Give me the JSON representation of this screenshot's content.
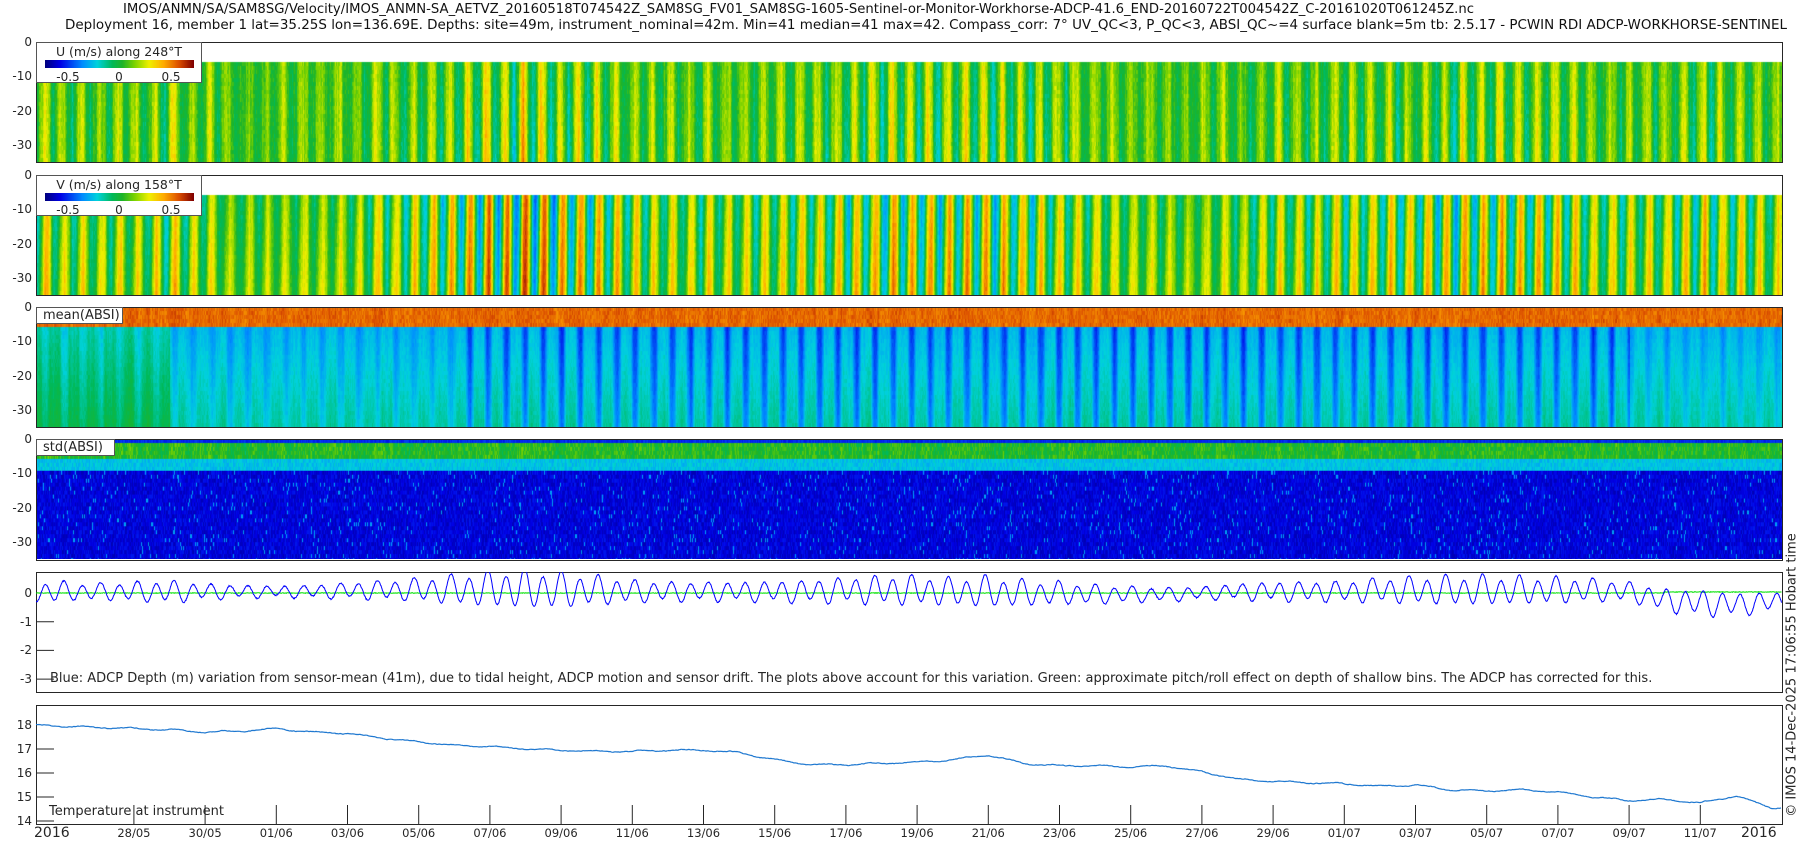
{
  "title": {
    "line1": "IMOS/ANMN/SA/SAM8SG/Velocity/IMOS_ANMN-SA_AETVZ_20160518T074542Z_SAM8SG_FV01_SAM8SG-1605-Sentinel-or-Monitor-Workhorse-ADCP-41.6_END-20160722T004542Z_C-20161020T061245Z.nc",
    "line2": "Deployment 16, member 1 lat=35.25S lon=136.69E. Depths: site=49m, instrument_nominal=42m. Min=41 median=41 max=42. Compass_corr: 7° UV_QC<3, P_QC<3, ABSI_QC~=4 surface blank=5m tb: 2.5.17 - PCWIN RDI ADCP-WORKHORSE-SENTINEL"
  },
  "credit": "© IMOS 14-Dec-2025 17:06:55 Hobart time",
  "colors": {
    "depth_line": "#0000ff",
    "pitchroll_line": "#00e000",
    "temp_line": "#1f78d0"
  },
  "chart_data": [
    {
      "type": "heatmap",
      "id": "u",
      "label": "U (m/s) along 248°T",
      "clim": [
        -0.7,
        0.7
      ],
      "colorbar_ticks": [
        "-0.5",
        "0",
        "0.5"
      ],
      "ylim": [
        -35,
        0
      ],
      "yticks": [
        "0",
        "-10",
        "-20",
        "-30"
      ],
      "surface_blank_m": 5
    },
    {
      "type": "heatmap",
      "id": "v",
      "label": "V (m/s) along 158°T",
      "clim": [
        -0.7,
        0.7
      ],
      "colorbar_ticks": [
        "-0.5",
        "0",
        "0.5"
      ],
      "ylim": [
        -35,
        0
      ],
      "yticks": [
        "0",
        "-10",
        "-20",
        "-30"
      ],
      "surface_blank_m": 5
    },
    {
      "type": "heatmap",
      "id": "mean_absi",
      "label": "mean(ABSI)",
      "ylim": [
        -35,
        0
      ],
      "yticks": [
        "0",
        "-10",
        "-20",
        "-30"
      ]
    },
    {
      "type": "heatmap",
      "id": "std_absi",
      "label": "std(ABSI)",
      "ylim": [
        -35,
        0
      ],
      "yticks": [
        "0",
        "-10",
        "-20",
        "-30"
      ]
    },
    {
      "type": "line",
      "id": "depth_variation",
      "caption": "Blue: ADCP Depth (m) variation from sensor-mean (41m), due to tidal height, ADCP motion and sensor drift. The plots above account for this variation. Green: approximate pitch/roll effect on depth of shallow bins. The ADCP has corrected for this.",
      "ylim": [
        -3.4,
        0.8
      ],
      "yticks": [
        "0",
        "-1",
        "-2",
        "-3"
      ],
      "x_start": "2016-05-25",
      "x_step_days": 1,
      "tidal_amplitude_m": [
        0.35,
        0.3,
        0.25,
        0.3,
        0.35,
        0.25,
        0.2,
        0.18,
        0.2,
        0.25,
        0.3,
        0.35,
        0.45,
        0.55,
        0.6,
        0.55,
        0.45,
        0.35,
        0.3,
        0.3,
        0.3,
        0.32,
        0.35,
        0.4,
        0.45,
        0.45,
        0.42,
        0.48,
        0.4,
        0.35,
        0.3,
        0.25,
        0.22,
        0.2,
        0.25,
        0.3,
        0.3,
        0.32,
        0.38,
        0.42,
        0.45,
        0.45,
        0.42,
        0.4,
        0.35,
        0.3,
        0.35,
        0.4,
        0.35,
        0.3
      ],
      "mean_offset_m": [
        0.05,
        0.05,
        0.05,
        0.05,
        0.05,
        0.05,
        0.05,
        0.05,
        0.05,
        0.08,
        0.1,
        0.12,
        0.12,
        0.15,
        0.15,
        0.1,
        0.1,
        0.05,
        0.05,
        0.05,
        0.05,
        0.05,
        0.05,
        0.1,
        0.1,
        0.1,
        0.05,
        0.05,
        0.0,
        0.0,
        -0.05,
        -0.05,
        -0.05,
        0.0,
        0.05,
        0.05,
        0.05,
        0.05,
        0.1,
        0.1,
        0.1,
        0.1,
        0.1,
        0.1,
        0.1,
        0.05,
        -0.25,
        -0.35,
        -0.4,
        -0.3
      ]
    },
    {
      "type": "line",
      "id": "temperature",
      "label": "Temperature at instrument",
      "ylim": [
        13.9,
        18.6
      ],
      "yticks": [
        "14",
        "15",
        "16",
        "17",
        "18"
      ],
      "x_start": "2016-05-25",
      "x_step_days": 1,
      "values": [
        18.0,
        17.95,
        17.9,
        17.85,
        17.8,
        17.7,
        17.75,
        17.85,
        17.7,
        17.65,
        17.45,
        17.3,
        17.15,
        17.1,
        17.0,
        16.95,
        16.9,
        16.9,
        16.95,
        16.95,
        16.85,
        16.55,
        16.35,
        16.35,
        16.4,
        16.45,
        16.55,
        16.75,
        16.4,
        16.3,
        16.3,
        16.25,
        16.3,
        16.05,
        15.75,
        15.65,
        15.6,
        15.55,
        15.45,
        15.5,
        15.3,
        15.25,
        15.3,
        15.2,
        15.0,
        14.85,
        14.9,
        14.75,
        15.05,
        14.55
      ]
    }
  ],
  "xaxis": {
    "year_left": "2016",
    "year_right": "2016",
    "ticks": [
      "28/05",
      "30/05",
      "01/06",
      "03/06",
      "05/06",
      "07/06",
      "09/06",
      "11/06",
      "13/06",
      "15/06",
      "17/06",
      "19/06",
      "21/06",
      "23/06",
      "25/06",
      "27/06",
      "29/06",
      "01/07",
      "03/07",
      "05/07",
      "07/07",
      "09/07",
      "11/07"
    ]
  }
}
